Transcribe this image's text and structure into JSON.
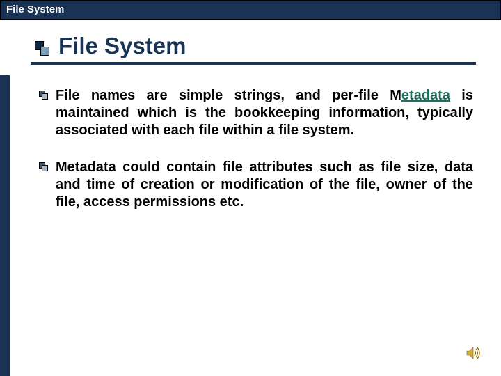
{
  "header": {
    "title": "File System"
  },
  "slide": {
    "title": "File System",
    "bullets": [
      {
        "pre": "File names are simple strings, and per-file M",
        "link": "etadata",
        "post": " is maintained which is the bookkeeping information, typically associated with each file within a file system."
      },
      {
        "pre": "Metadata could contain file attributes such as file size, data and time of creation or modification of the file, owner of the file, access permissions etc.",
        "link": "",
        "post": ""
      }
    ]
  }
}
